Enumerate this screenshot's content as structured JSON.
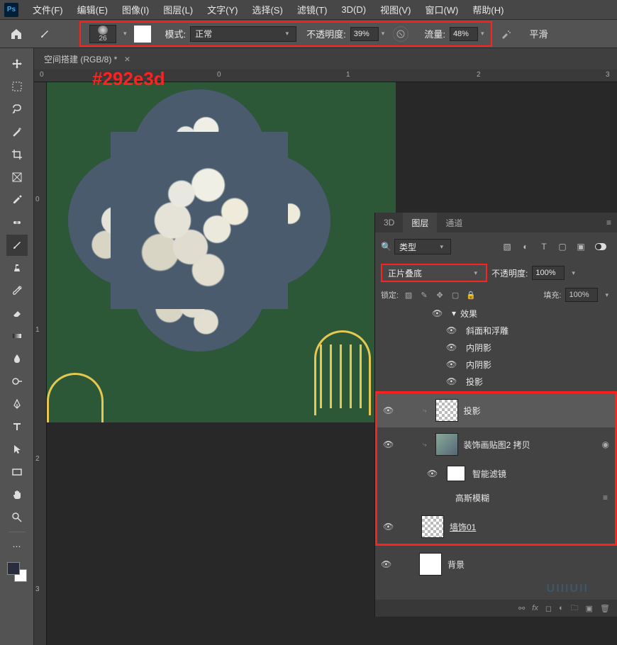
{
  "menubar": {
    "items": [
      "文件(F)",
      "编辑(E)",
      "图像(I)",
      "图层(L)",
      "文字(Y)",
      "选择(S)",
      "滤镜(T)",
      "3D(D)",
      "视图(V)",
      "窗口(W)",
      "帮助(H)"
    ]
  },
  "optbar": {
    "brush_size": "26",
    "mode_label": "模式:",
    "mode_value": "正常",
    "opacity_label": "不透明度:",
    "opacity_value": "39%",
    "flow_label": "流量:",
    "flow_value": "48%",
    "smooth_label": "平滑"
  },
  "tab": {
    "title": "空间搭建              (RGB/8) *"
  },
  "hex_annotation": "#292e3d",
  "ruler_h": [
    "0",
    "0",
    "1",
    "2",
    "3"
  ],
  "ruler_v": [
    "0",
    "1",
    "2",
    "3"
  ],
  "panel": {
    "tabs": [
      "3D",
      "图层",
      "通道"
    ],
    "filter_label": "类型",
    "blend_mode": "正片叠底",
    "opacity_label": "不透明度:",
    "opacity_value": "100%",
    "lock_label": "锁定:",
    "fill_label": "填充:",
    "fill_value": "100%",
    "fx": {
      "group": "效果",
      "items": [
        "斜面和浮雕",
        "内阴影",
        "内阴影",
        "投影"
      ]
    },
    "layers": [
      {
        "name": "投影"
      },
      {
        "name": "装饰画贴图2 拷贝"
      },
      {
        "smart": "智能滤镜"
      },
      {
        "blur": "高斯模糊"
      },
      {
        "name": "墙饰01"
      },
      {
        "name": "背景"
      }
    ]
  },
  "watermark": "UIIIUII"
}
